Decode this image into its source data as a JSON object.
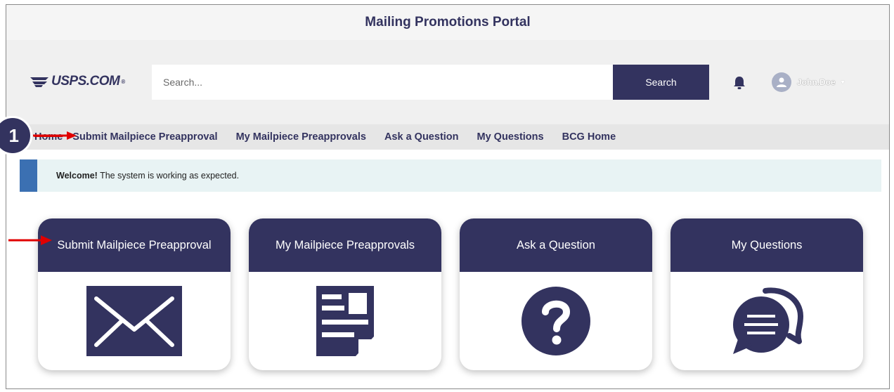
{
  "page": {
    "title": "Mailing Promotions Portal"
  },
  "header": {
    "logo_text": "USPS.COM",
    "logo_tm": "®",
    "search_placeholder": "Search...",
    "search_button": "Search",
    "username": "John.Doe",
    "user_caret": "▾"
  },
  "nav": {
    "items": [
      {
        "label": "Home"
      },
      {
        "label": "Submit Mailpiece Preapproval"
      },
      {
        "label": "My Mailpiece Preapprovals"
      },
      {
        "label": "Ask a Question"
      },
      {
        "label": "My Questions"
      },
      {
        "label": "BCG Home"
      }
    ]
  },
  "annotation": {
    "step_number": "1"
  },
  "alert": {
    "strong": "Welcome!",
    "message": " The system is working as expected."
  },
  "cards": [
    {
      "title": "Submit Mailpiece Preapproval",
      "icon": "envelope-icon"
    },
    {
      "title": "My Mailpiece Preapprovals",
      "icon": "document-icon"
    },
    {
      "title": "Ask a Question",
      "icon": "question-icon"
    },
    {
      "title": "My Questions",
      "icon": "chat-bubbles-icon"
    }
  ],
  "colors": {
    "brand_navy": "#33335f",
    "alert_accent": "#3b70b2",
    "alert_bg": "#e8f3f4",
    "annotation_red": "#e00000"
  }
}
